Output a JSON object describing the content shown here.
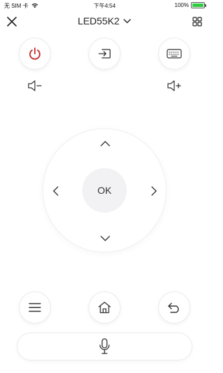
{
  "status_bar": {
    "carrier": "无 SIM 卡",
    "time": "下午4:54",
    "battery_percent_text": "100%",
    "battery_level": 1.0,
    "battery_color": "#2ecc40"
  },
  "nav": {
    "title": "LED55K2",
    "close_icon": "close-icon",
    "dropdown_icon": "chevron-down-icon",
    "grid_icon": "grid-icon"
  },
  "top_buttons": {
    "power_icon": "power-icon",
    "power_color": "#c62828",
    "input_icon": "input-source-icon",
    "keyboard_icon": "keyboard-icon"
  },
  "volume": {
    "down_icon": "volume-down-icon",
    "up_icon": "volume-up-icon"
  },
  "dpad": {
    "ok_label": "OK",
    "up_icon": "chevron-up-icon",
    "down_icon": "chevron-down-icon",
    "left_icon": "chevron-left-icon",
    "right_icon": "chevron-right-icon"
  },
  "bottom_buttons": {
    "menu_icon": "menu-icon",
    "home_icon": "home-icon",
    "back_icon": "back-icon"
  },
  "voice": {
    "mic_icon": "microphone-icon"
  }
}
